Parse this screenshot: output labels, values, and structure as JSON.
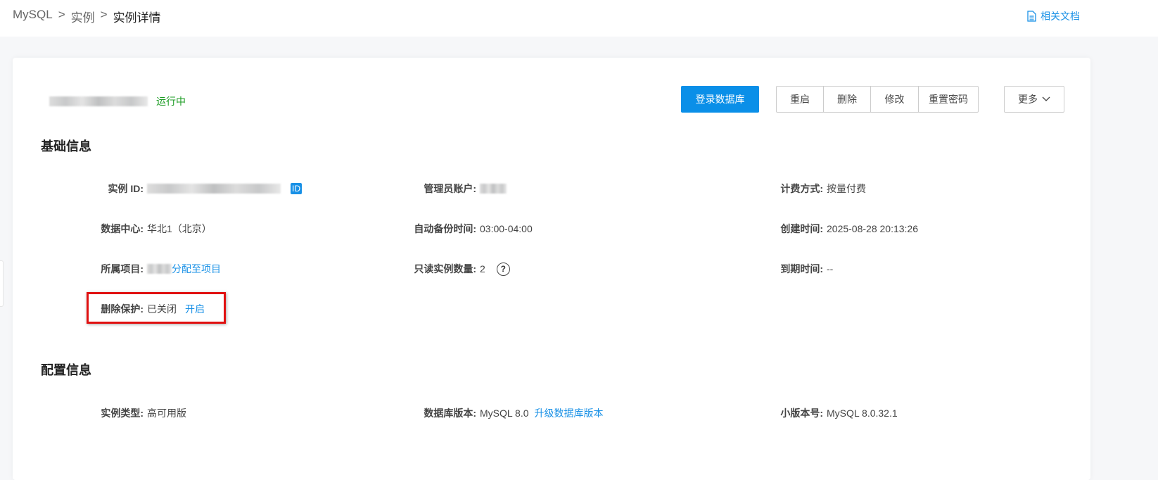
{
  "breadcrumb": {
    "items": [
      "MySQL",
      "实例",
      "实例详情"
    ],
    "separator": ">"
  },
  "header": {
    "docs_link": "相关文档"
  },
  "instance": {
    "status": "运行中",
    "status_color": "#1a9b22"
  },
  "toolbar": {
    "login_db": "登录数据库",
    "restart": "重启",
    "delete": "删除",
    "modify": "修改",
    "reset_password": "重置密码",
    "more": "更多"
  },
  "basic": {
    "title": "基础信息",
    "instance_id_label": "实例 ID:",
    "id_badge": "ID",
    "admin_label": "管理员账户:",
    "billing_label": "计费方式:",
    "billing_value": "按量付费",
    "datacenter_label": "数据中心:",
    "datacenter_value": "华北1（北京）",
    "backup_label": "自动备份时间:",
    "backup_value": "03:00-04:00",
    "created_label": "创建时间:",
    "created_value": "2025-08-28 20:13:26",
    "project_label": "所属项目:",
    "project_link": "分配至项目",
    "readonly_label": "只读实例数量:",
    "readonly_value": "2",
    "expire_label": "到期时间:",
    "expire_value": "--",
    "protect_label": "删除保护:",
    "protect_value": "已关闭",
    "protect_link": "开启"
  },
  "config": {
    "title": "配置信息",
    "type_label": "实例类型:",
    "type_value": "高可用版",
    "version_label": "数据库版本:",
    "version_value": "MySQL 8.0",
    "upgrade_link": "升级数据库版本",
    "minor_label": "小版本号:",
    "minor_value": "MySQL 8.0.32.1"
  }
}
